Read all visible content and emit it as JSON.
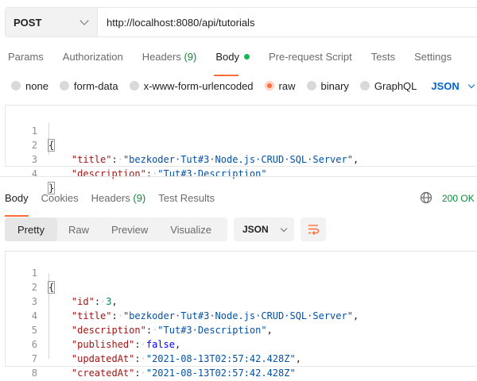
{
  "request": {
    "method": "POST",
    "url": "http://localhost:8080/api/tutorials"
  },
  "request_tabs": [
    {
      "label": "Params"
    },
    {
      "label": "Authorization"
    },
    {
      "label": "Headers",
      "count": "(9)"
    },
    {
      "label": "Body",
      "active": true
    },
    {
      "label": "Pre-request Script"
    },
    {
      "label": "Tests"
    },
    {
      "label": "Settings"
    }
  ],
  "body_types": [
    {
      "label": "none"
    },
    {
      "label": "form-data"
    },
    {
      "label": "x-www-form-urlencoded"
    },
    {
      "label": "raw",
      "selected": true
    },
    {
      "label": "binary"
    },
    {
      "label": "GraphQL"
    }
  ],
  "raw_format": "JSON",
  "request_body": {
    "line_numbers": [
      "1",
      "2",
      "3",
      "4"
    ],
    "open": "{",
    "close": "}",
    "title_key": "\"title\"",
    "title_value": "\"bezkoder·Tut#3·Node.js·CRUD·SQL·Server\"",
    "description_key": "\"description\"",
    "description_value": "\"Tut#3·Description\""
  },
  "response_tabs": [
    {
      "label": "Body",
      "active": true
    },
    {
      "label": "Cookies"
    },
    {
      "label": "Headers",
      "count": "(9)"
    },
    {
      "label": "Test Results"
    }
  ],
  "status": "200 OK",
  "view_modes": [
    "Pretty",
    "Raw",
    "Preview",
    "Visualize"
  ],
  "active_view": "Pretty",
  "response_format": "JSON",
  "response_body": {
    "line_numbers": [
      "1",
      "2",
      "3",
      "4",
      "5",
      "6",
      "7",
      "8"
    ],
    "open": "{",
    "close": "}",
    "id_key": "\"id\"",
    "id_value": "3",
    "title_key": "\"title\"",
    "title_value": "\"bezkoder·Tut#3·Node.js·CRUD·SQL·Server\"",
    "description_key": "\"description\"",
    "description_value": "\"Tut#3·Description\"",
    "published_key": "\"published\"",
    "published_value": "false",
    "updatedAt_key": "\"updatedAt\"",
    "updatedAt_value": "\"2021-08-13T02:57:42.428Z\"",
    "createdAt_key": "\"createdAt\"",
    "createdAt_value": "\"2021-08-13T02:57:42.428Z\""
  },
  "colors": {
    "accent": "#ff6c37",
    "status_ok": "#0c8a3a",
    "link_blue": "#0265d2",
    "dot_green": "#0cbb52"
  },
  "icons": [
    "chevron-down-icon",
    "globe-icon",
    "wrap-lines-icon"
  ]
}
